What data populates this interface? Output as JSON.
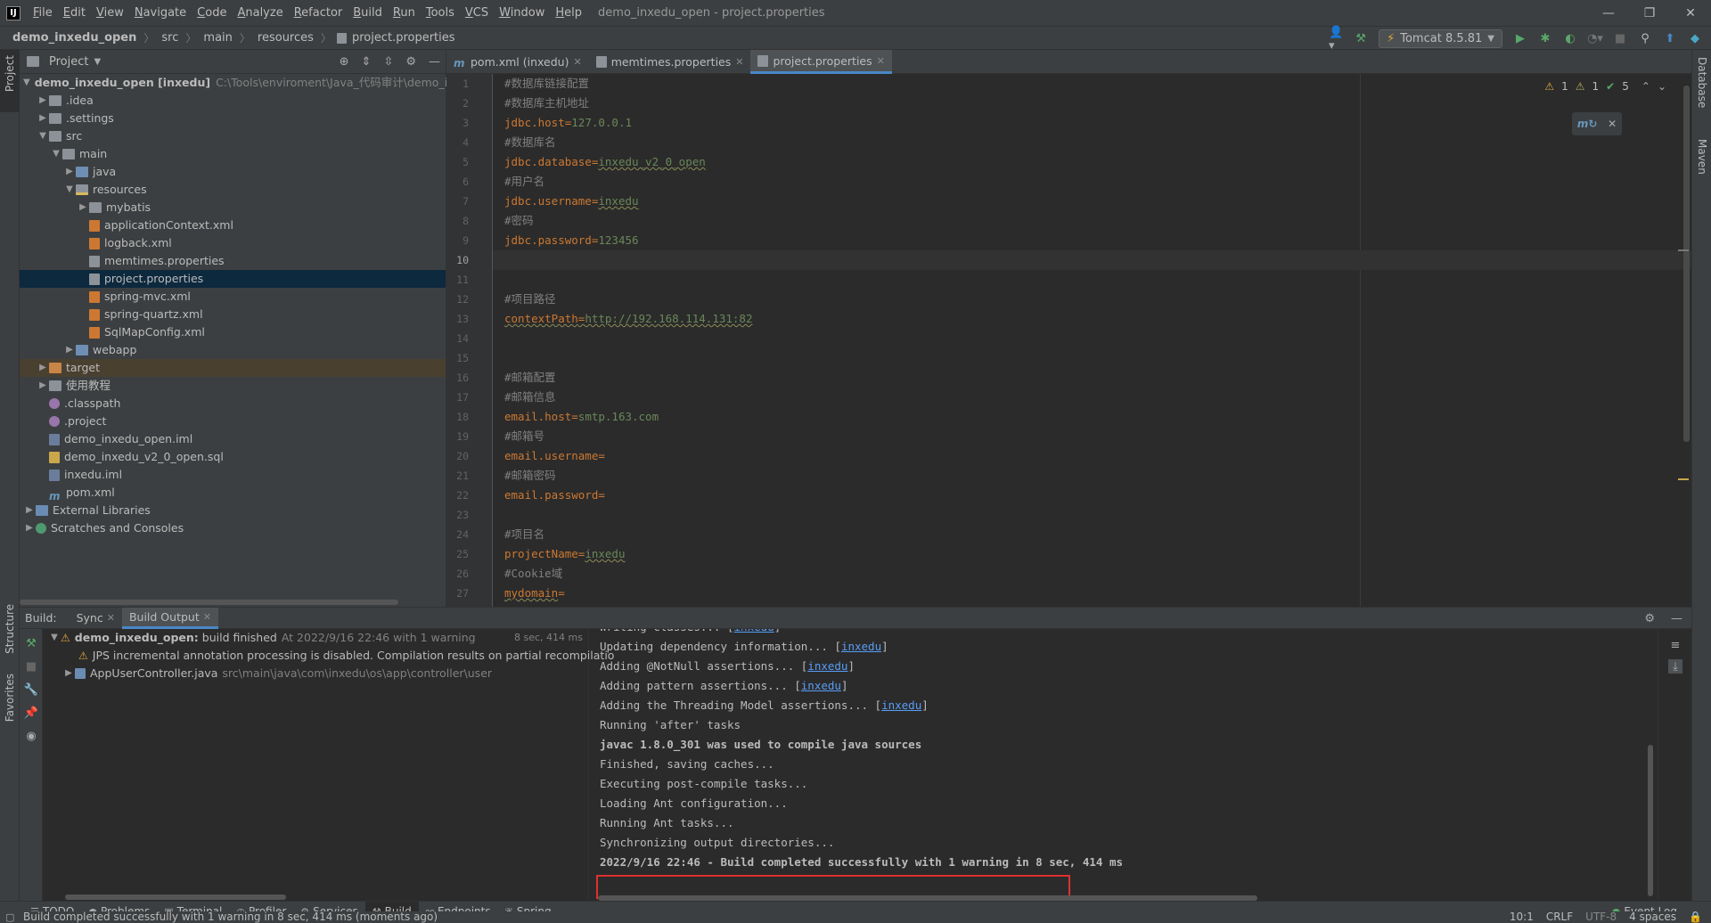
{
  "window": {
    "title": "demo_inxedu_open - project.properties",
    "minimize": "—",
    "restore": "❐",
    "close": "✕"
  },
  "menu": [
    "File",
    "Edit",
    "View",
    "Navigate",
    "Code",
    "Analyze",
    "Refactor",
    "Build",
    "Run",
    "Tools",
    "VCS",
    "Window",
    "Help"
  ],
  "breadcrumb": [
    "demo_inxedu_open",
    "src",
    "main",
    "resources",
    "project.properties"
  ],
  "run_config": {
    "label": "Tomcat 8.5.81"
  },
  "left_strip": {
    "project": "Project",
    "structure": "Structure",
    "favorites": "Favorites"
  },
  "right_strip": {
    "database": "Database",
    "maven": "Maven"
  },
  "project_panel": {
    "title": "Project",
    "tree": [
      {
        "indent": 0,
        "arrow": "down",
        "icon": "folder",
        "label": "demo_inxedu_open [inxedu]",
        "bold": true,
        "path": "C:\\Tools\\enviroment\\Java_代码审计\\demo_inx"
      },
      {
        "indent": 1,
        "arrow": "right",
        "icon": "folder",
        "label": ".idea"
      },
      {
        "indent": 1,
        "arrow": "right",
        "icon": "folder",
        "label": ".settings"
      },
      {
        "indent": 1,
        "arrow": "down",
        "icon": "folder",
        "label": "src"
      },
      {
        "indent": 2,
        "arrow": "down",
        "icon": "folder",
        "label": "main"
      },
      {
        "indent": 3,
        "arrow": "right",
        "icon": "folder-src",
        "label": "java"
      },
      {
        "indent": 3,
        "arrow": "down",
        "icon": "folder-res",
        "label": "resources"
      },
      {
        "indent": 4,
        "arrow": "right",
        "icon": "folder",
        "label": "mybatis"
      },
      {
        "indent": 4,
        "arrow": "",
        "icon": "xml",
        "label": "applicationContext.xml"
      },
      {
        "indent": 4,
        "arrow": "",
        "icon": "xml",
        "label": "logback.xml"
      },
      {
        "indent": 4,
        "arrow": "",
        "icon": "prop",
        "label": "memtimes.properties"
      },
      {
        "indent": 4,
        "arrow": "",
        "icon": "prop",
        "label": "project.properties",
        "selected": true
      },
      {
        "indent": 4,
        "arrow": "",
        "icon": "xml",
        "label": "spring-mvc.xml"
      },
      {
        "indent": 4,
        "arrow": "",
        "icon": "xml",
        "label": "spring-quartz.xml"
      },
      {
        "indent": 4,
        "arrow": "",
        "icon": "xml",
        "label": "SqlMapConfig.xml"
      },
      {
        "indent": 3,
        "arrow": "right",
        "icon": "folder-src",
        "label": "webapp"
      },
      {
        "indent": 1,
        "arrow": "right",
        "icon": "folder-orange",
        "label": "target",
        "excluded": true
      },
      {
        "indent": 1,
        "arrow": "right",
        "icon": "folder",
        "label": "使用教程"
      },
      {
        "indent": 1,
        "arrow": "",
        "icon": "dot",
        "label": ".classpath"
      },
      {
        "indent": 1,
        "arrow": "",
        "icon": "dot",
        "label": ".project"
      },
      {
        "indent": 1,
        "arrow": "",
        "icon": "iml",
        "label": "demo_inxedu_open.iml"
      },
      {
        "indent": 1,
        "arrow": "",
        "icon": "sql",
        "label": "demo_inxedu_v2_0_open.sql"
      },
      {
        "indent": 1,
        "arrow": "",
        "icon": "iml",
        "label": "inxedu.iml"
      },
      {
        "indent": 1,
        "arrow": "",
        "icon": "m",
        "label": "pom.xml"
      },
      {
        "indent": 0,
        "arrow": "right",
        "icon": "lib",
        "label": "External Libraries"
      },
      {
        "indent": 0,
        "arrow": "right",
        "icon": "scratch",
        "label": "Scratches and Consoles"
      }
    ]
  },
  "editor": {
    "tabs": [
      {
        "label": "pom.xml (inxedu)",
        "icon": "m",
        "active": false
      },
      {
        "label": "memtimes.properties",
        "icon": "prop",
        "active": false
      },
      {
        "label": "project.properties",
        "icon": "prop",
        "active": true
      }
    ],
    "inspections": {
      "warn1": "1",
      "warn2": "1",
      "ok": "5"
    },
    "current_line": 10,
    "lines": [
      {
        "n": "1",
        "comment": "#数据库链接配置"
      },
      {
        "n": "2",
        "comment": "#数据库主机地址"
      },
      {
        "n": "3",
        "key": "jdbc.host",
        "value": "127.0.0.1"
      },
      {
        "n": "4",
        "comment": "#数据库名"
      },
      {
        "n": "5",
        "key": "jdbc.database",
        "value": "inxedu_v2_0_open",
        "squiggle": true
      },
      {
        "n": "6",
        "comment": "#用户名"
      },
      {
        "n": "7",
        "key": "jdbc.username",
        "value": "inxedu",
        "squiggle": true
      },
      {
        "n": "8",
        "comment": "#密码"
      },
      {
        "n": "9",
        "key": "jdbc.password",
        "value": "123456"
      },
      {
        "n": "10"
      },
      {
        "n": "11"
      },
      {
        "n": "12",
        "comment": "#项目路径"
      },
      {
        "n": "13",
        "key": "contextPath",
        "value": "http://192.168.114.131:82",
        "squiggle_all": true
      },
      {
        "n": "14"
      },
      {
        "n": "15"
      },
      {
        "n": "16",
        "comment": "#邮箱配置"
      },
      {
        "n": "17",
        "comment": "#邮箱信息"
      },
      {
        "n": "18",
        "key": "email.host",
        "value": "smtp.163.com"
      },
      {
        "n": "19",
        "comment": "#邮箱号"
      },
      {
        "n": "20",
        "key": "email.username",
        "value": ""
      },
      {
        "n": "21",
        "comment": "#邮箱密码"
      },
      {
        "n": "22",
        "key": "email.password",
        "value": ""
      },
      {
        "n": "23"
      },
      {
        "n": "24",
        "comment": "#项目名"
      },
      {
        "n": "25",
        "key": "projectName",
        "value": "inxedu",
        "squiggle": true
      },
      {
        "n": "26",
        "comment": "#Cookie域"
      },
      {
        "n": "27",
        "key": "mydomain",
        "value": "",
        "squiggle_key": true
      }
    ]
  },
  "build": {
    "label": "Build:",
    "tabs": [
      {
        "label": "Sync",
        "active": false
      },
      {
        "label": "Build Output",
        "active": true
      }
    ],
    "tree": {
      "root_name": "demo_inxedu_open:",
      "root_status": "build finished",
      "root_meta": "At 2022/9/16 22:46 with 1 warning",
      "root_time": "8 sec, 414 ms",
      "warning": "JPS incremental annotation processing is disabled. Compilation results on partial recompilatio",
      "file_name": "AppUserController.java",
      "file_path": "src\\main\\java\\com\\inxedu\\os\\app\\controller\\user"
    },
    "output": [
      {
        "text": "Writing classes... [",
        "link": "inxedu",
        "tail": "]",
        "bold": false
      },
      {
        "text": "Updating dependency information... [",
        "link": "inxedu",
        "tail": "]",
        "bold": false
      },
      {
        "text": "Adding @NotNull assertions... [",
        "link": "inxedu",
        "tail": "]",
        "bold": false
      },
      {
        "text": "Adding pattern assertions... [",
        "link": "inxedu",
        "tail": "]",
        "bold": false
      },
      {
        "text": "Adding the Threading Model assertions... [",
        "link": "inxedu",
        "tail": "]",
        "bold": false
      },
      {
        "text": "Running 'after' tasks",
        "bold": false
      },
      {
        "text": "javac 1.8.0_301 was used to compile java sources",
        "bold": true
      },
      {
        "text": "Finished, saving caches...",
        "bold": false
      },
      {
        "text": "Executing post-compile tasks...",
        "bold": false
      },
      {
        "text": "Loading Ant configuration...",
        "bold": false
      },
      {
        "text": "Running Ant tasks...",
        "bold": false
      },
      {
        "text": "Synchronizing output directories...",
        "bold": false
      },
      {
        "text": "2022/9/16 22:46 - Build completed successfully with 1 warning in 8 sec, 414 ms",
        "bold": true
      }
    ]
  },
  "bottom_tools": [
    {
      "label": "TODO",
      "icon": "list-icon",
      "active": false
    },
    {
      "label": "Problems",
      "icon": "problems-icon",
      "active": false
    },
    {
      "label": "Terminal",
      "icon": "terminal-icon",
      "active": false
    },
    {
      "label": "Profiler",
      "icon": "profiler-icon",
      "active": false
    },
    {
      "label": "Services",
      "icon": "services-icon",
      "active": false
    },
    {
      "label": "Build",
      "icon": "hammer-icon",
      "active": true
    },
    {
      "label": "Endpoints",
      "icon": "endpoints-icon",
      "active": false
    },
    {
      "label": "Spring",
      "icon": "spring-icon",
      "active": false
    }
  ],
  "event_log": "Event Log",
  "status": {
    "message": "Build completed successfully with 1 warning in 8 sec, 414 ms (moments ago)",
    "position": "10:1",
    "line_sep": "CRLF",
    "encoding": "UTF-8",
    "indent": "4 spaces"
  },
  "colors": {
    "accent": "#4a88c7",
    "highlight_box": "#e03030",
    "warning": "#e0a83c",
    "success": "#59a869",
    "link": "#589df6"
  }
}
